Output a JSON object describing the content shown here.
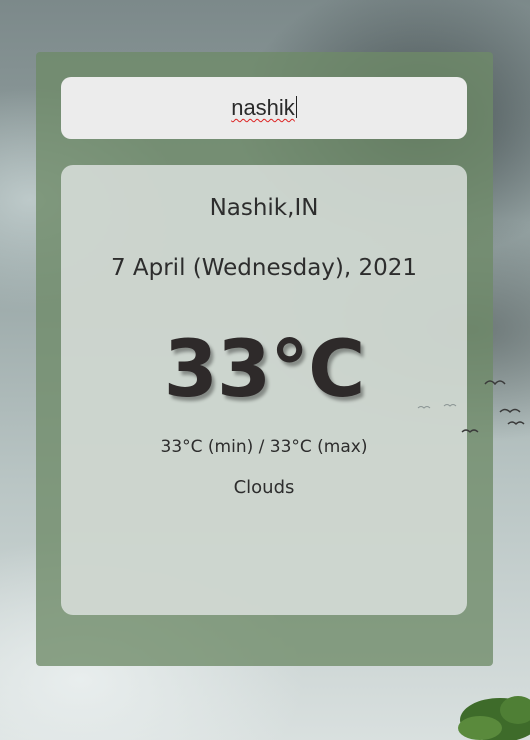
{
  "search": {
    "value": "nashik",
    "spell_error": true
  },
  "weather": {
    "location": "Nashik,IN",
    "date": "7 April (Wednesday), 2021",
    "temperature": "33°C",
    "min_max": "33°C (min) / 33°C (max)",
    "condition": "Clouds"
  },
  "colors": {
    "panel": "#6e8a68",
    "card": "#dee3e0",
    "search_bg": "#ececec",
    "text": "#2d2d2d"
  }
}
